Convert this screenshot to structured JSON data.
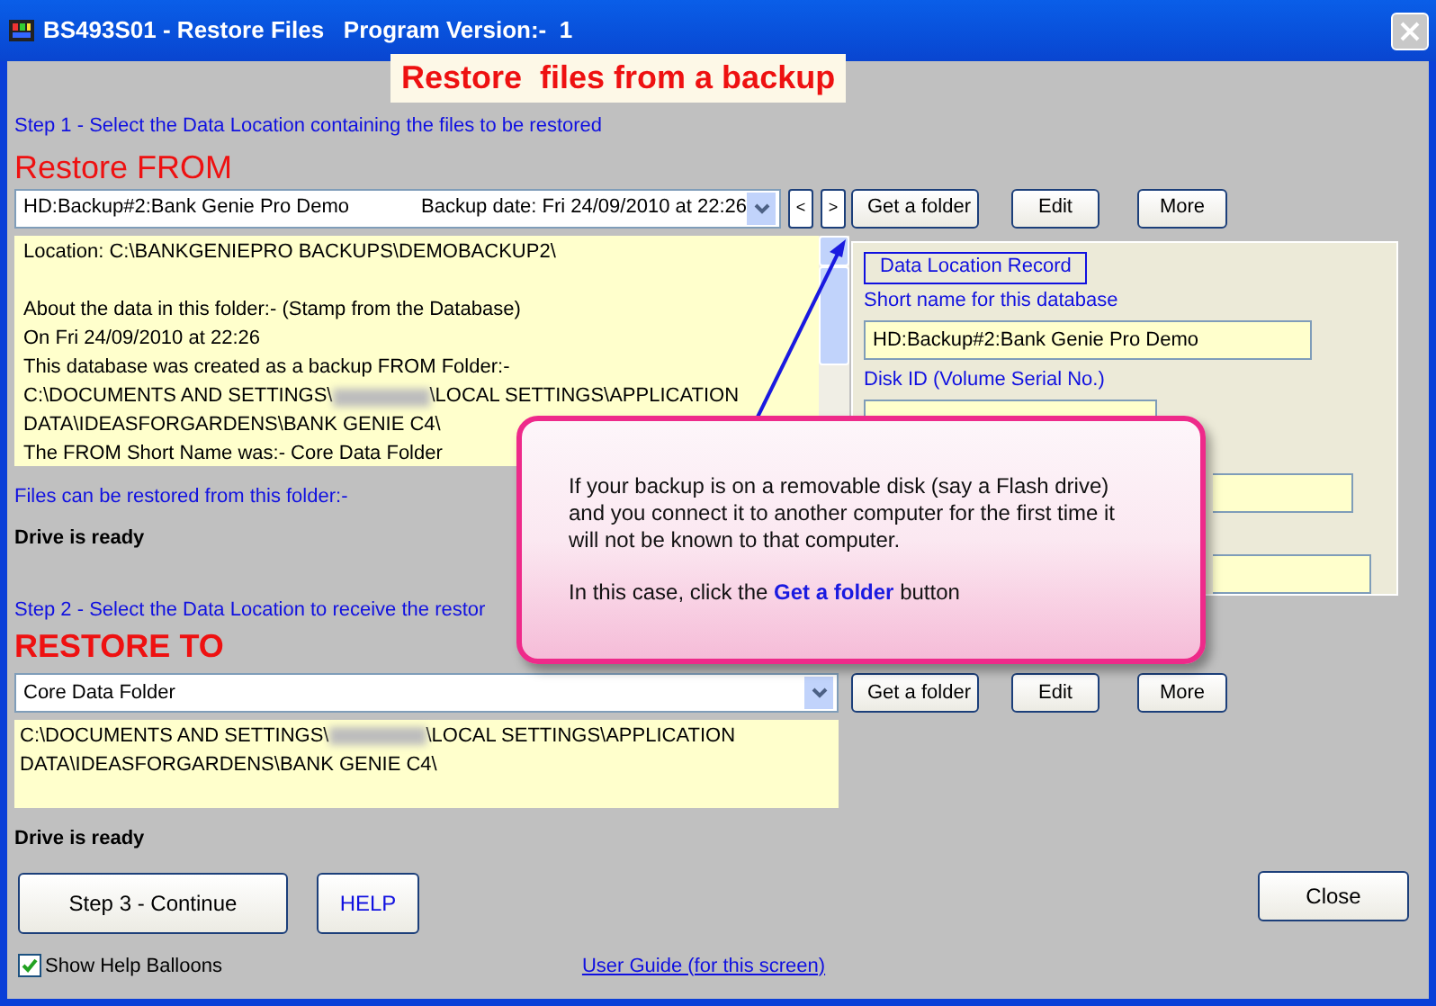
{
  "window": {
    "title": "BS493S01 - Restore Files   Program Version:-  1"
  },
  "banner": "Restore  files from a backup",
  "step1": {
    "instruction": "Step 1 - Select the Data Location containing the files to be restored",
    "heading": "Restore FROM",
    "combo": {
      "value": "HD:Backup#2:Bank Genie Pro Demo",
      "backup_date": "Backup date: Fri 24/09/2010 at 22:26"
    },
    "nav_buttons": [
      "<",
      ">"
    ],
    "buttons": [
      "Get a folder",
      "Edit",
      "More"
    ],
    "info_lines": [
      [
        "Location: C:\\BANKGENIEPRO BACKUPS\\DEMOBACKUP2\\"
      ],
      [
        "About the data in this folder:- (Stamp from the Database)"
      ],
      [
        "On Fri 24/09/2010 at 22:26"
      ],
      [
        "This database was created as a backup FROM Folder:-"
      ],
      [
        "C:\\DOCUMENTS AND SETTINGS\\",
        "\\LOCAL SETTINGS\\APPLICATION"
      ],
      [
        "DATA\\IDEASFORGARDENS\\BANK GENIE C4\\"
      ],
      [
        "The FROM Short Name was:- Core Data Folder"
      ]
    ],
    "files_label": "Files can be restored from this folder:-",
    "drive_status": "Drive is ready"
  },
  "record_panel": {
    "title": "Data Location Record",
    "short_name_label": "Short name for this database",
    "short_name": "HD:Backup#2:Bank Genie Pro Demo",
    "disk_id_label": "Disk ID (Volume Serial No.)"
  },
  "step2": {
    "instruction": "Step 2 - Select the Data Location to receive the restor",
    "heading": "RESTORE TO",
    "combo": {
      "value": "Core Data Folder"
    },
    "buttons": [
      "Get a folder",
      "Edit",
      "More"
    ],
    "path_lines": [
      [
        "C:\\DOCUMENTS AND SETTINGS\\",
        "\\LOCAL SETTINGS\\APPLICATION"
      ],
      [
        "DATA\\IDEASFORGARDENS\\BANK GENIE C4\\"
      ]
    ],
    "drive_status": "Drive is ready"
  },
  "continue_button": "Step 3 - Continue",
  "help_button": "HELP",
  "close_button": "Close",
  "show_help_balloons": {
    "label": "Show Help Balloons",
    "checked": true
  },
  "user_guide_link": "User Guide (for this screen)",
  "balloon": {
    "paragraphs": [
      "If your backup is on a removable disk (say a Flash drive) and you connect it to another computer for the first time it will not be known to that computer.",
      "In this case, click the **Get a folder** button"
    ]
  }
}
